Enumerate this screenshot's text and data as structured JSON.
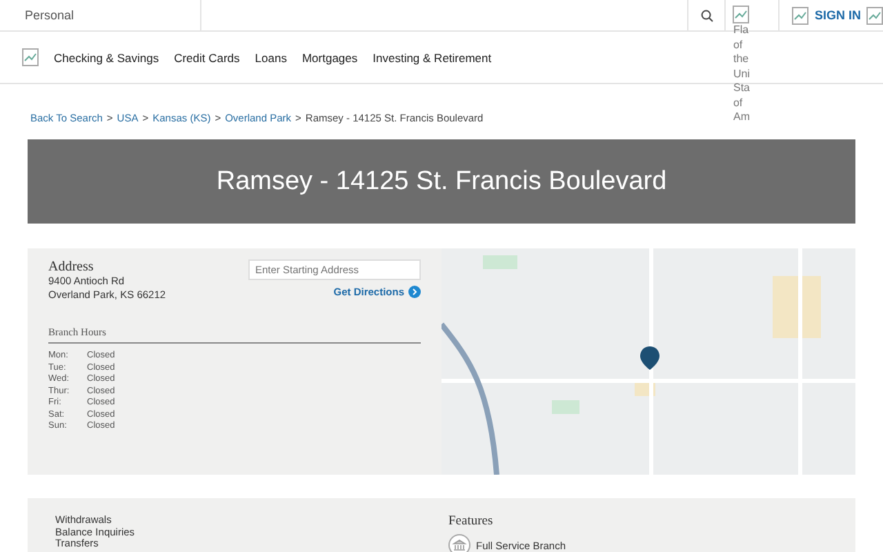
{
  "top_bar": {
    "segment": "Personal",
    "flag_alt_lines": [
      "Fla",
      "of",
      "the",
      "Uni",
      "Sta",
      "of",
      "Am"
    ],
    "sign_in": "SIGN IN"
  },
  "nav": {
    "items": [
      "Checking & Savings",
      "Credit Cards",
      "Loans",
      "Mortgages",
      "Investing & Retirement"
    ]
  },
  "breadcrumb": {
    "separator": ">",
    "links": [
      "Back To Search",
      "USA",
      "Kansas (KS)",
      "Overland Park"
    ],
    "current": "Ramsey - 14125 St. Francis Boulevard"
  },
  "banner": {
    "title": "Ramsey - 14125 St. Francis Boulevard"
  },
  "branch": {
    "address_heading": "Address",
    "address_lines": [
      "9400 Antioch Rd",
      "Overland Park, KS 66212"
    ],
    "directions_placeholder": "Enter Starting Address",
    "directions_button": "Get Directions",
    "hours_heading": "Branch Hours",
    "hours": [
      {
        "day": "Mon:",
        "status": "Closed"
      },
      {
        "day": "Tue:",
        "status": "Closed"
      },
      {
        "day": "Wed:",
        "status": "Closed"
      },
      {
        "day": "Thur:",
        "status": "Closed"
      },
      {
        "day": "Fri:",
        "status": "Closed"
      },
      {
        "day": "Sat:",
        "status": "Closed"
      },
      {
        "day": "Sun:",
        "status": "Closed"
      }
    ]
  },
  "services": {
    "items": [
      "Withdrawals",
      "Balance Inquiries",
      "Transfers"
    ]
  },
  "features": {
    "heading": "Features",
    "items": [
      "Full Service Branch"
    ]
  }
}
